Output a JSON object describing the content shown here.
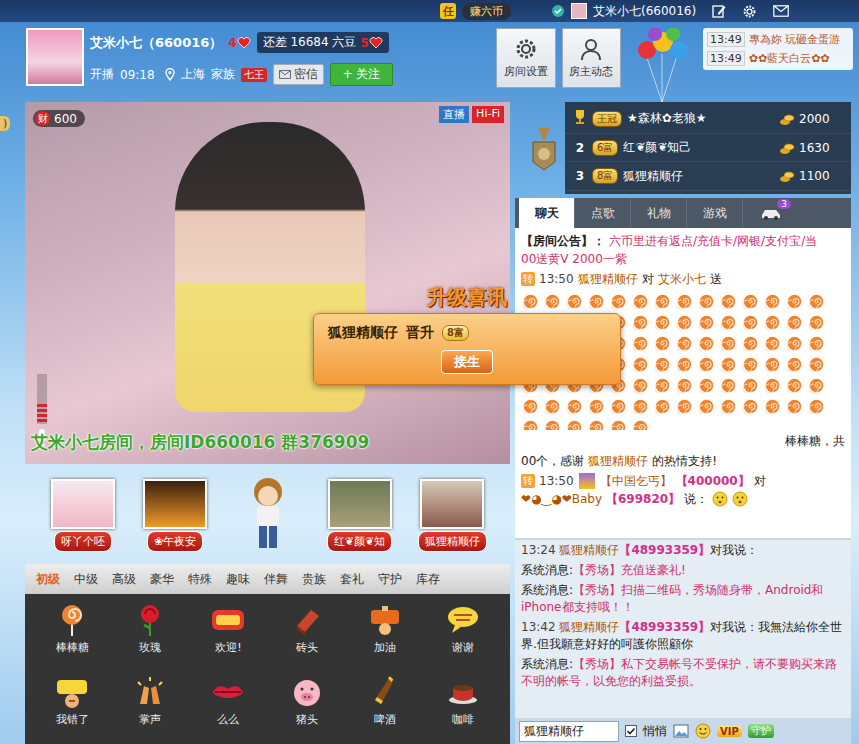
{
  "topbar": {
    "task_badge": "任",
    "task": "赚六币",
    "user": "艾米小七(660016)"
  },
  "host": {
    "name": "艾米小七（660016）",
    "level": "4",
    "needs": "还差 16684 六豆",
    "next_level": "5",
    "live_label": "开播",
    "live_time": "09:18",
    "city": "上海",
    "family_label": "家族",
    "family": "七王",
    "message": "密信",
    "follow": "+ 关注"
  },
  "actions": [
    {
      "label": "房间设置"
    },
    {
      "label": "房主动态"
    }
  ],
  "notices": [
    {
      "time": "13:49",
      "text": "專為妳 玩砸金蛋游"
    },
    {
      "time": "13:49",
      "text": "✿✿藍天白云✿✿"
    }
  ],
  "side_tab": ")",
  "video": {
    "wealth_icon": "财",
    "wealth": "600",
    "live": "直播",
    "hifi": "Hi-Fi",
    "banner": "艾米小七房间，房间ID660016 群376909",
    "mic_level": 0.4
  },
  "popup": {
    "title": "升级喜讯",
    "user": "狐狸精顺仔",
    "verb": "晋升",
    "badge": "8富",
    "button": "接生"
  },
  "audience": [
    {
      "kind": "user",
      "name": "呀丫个呸"
    },
    {
      "kind": "user",
      "name": "❀午夜安"
    },
    {
      "kind": "mascot"
    },
    {
      "kind": "user",
      "name": "红❦颜❦知"
    },
    {
      "kind": "user",
      "name": "狐狸精顺仔"
    }
  ],
  "gift_tabs": [
    {
      "label": "初级",
      "selected": true
    },
    {
      "label": "中级",
      "selected": false
    },
    {
      "label": "高级",
      "selected": false
    },
    {
      "label": "豪华",
      "selected": false
    },
    {
      "label": "特殊",
      "selected": false
    },
    {
      "label": "趣味",
      "selected": false
    },
    {
      "label": "伴舞",
      "selected": false
    },
    {
      "label": "贵族",
      "selected": false
    },
    {
      "label": "套礼",
      "selected": false
    },
    {
      "label": "守护",
      "selected": false
    },
    {
      "label": "库存",
      "selected": false
    }
  ],
  "gifts": [
    {
      "label": "棒棒糖"
    },
    {
      "label": "玫瑰"
    },
    {
      "label": "欢迎!"
    },
    {
      "label": "砖头"
    },
    {
      "label": "加油"
    },
    {
      "label": "谢谢"
    },
    {
      "label": "我错了"
    },
    {
      "label": "掌声"
    },
    {
      "label": "么么"
    },
    {
      "label": "猪头"
    },
    {
      "label": "啤酒"
    },
    {
      "label": "咖啡"
    }
  ],
  "ranking": [
    {
      "kind": "cup",
      "badge": "王冠",
      "name": "★森林✿老狼★",
      "score": "2000"
    },
    {
      "kind": "number",
      "rank": "2",
      "badge": "6富",
      "name": "红❦颜❦知己",
      "score": "1630"
    },
    {
      "kind": "number",
      "rank": "3",
      "badge": "8富",
      "name": "狐狸精顺仔",
      "score": "1100"
    }
  ],
  "chat_tabs": [
    {
      "label": "聊天",
      "selected": true
    },
    {
      "label": "点歌",
      "selected": false
    },
    {
      "label": "礼物",
      "selected": false
    },
    {
      "label": "游戏",
      "selected": false
    }
  ],
  "car_badge": "3",
  "chat": {
    "notice": {
      "label": "【房间公告】：",
      "lines": [
        "六币里进有返点/充值卡/网银/支付宝/当",
        "00送黄V 2000一紫"
      ]
    },
    "gift": {
      "tag": "转",
      "time": "13:50",
      "from": "狐狸精顺仔",
      "verb": "对",
      "to": "艾米小七",
      "action": "送",
      "item": "棒棒糖，共",
      "count": "00个，感谢",
      "user": "狐狸精顺仔",
      "tail": "的热情支持!"
    },
    "speech": {
      "tag": "转",
      "time": "13:50",
      "from": "【中国乞丐】",
      "from_id": "【400000】",
      "verb": "对",
      "to": "❤◕‿◕❤Baby",
      "to_id": "【699820】",
      "said": "说："
    }
  },
  "history": [
    {
      "kind": "private",
      "time": "13:24",
      "from": "狐狸精顺仔",
      "id": "【48993359】",
      "said": "对我说："
    },
    {
      "kind": "system",
      "label": "系统消息:",
      "tag": "【秀场】",
      "text": "充值送豪礼!"
    },
    {
      "kind": "system",
      "label": "系统消息:",
      "tag": "【秀场】",
      "text": "扫描二维码，秀场随身带，Android和iPhone都支持哦！！"
    },
    {
      "kind": "private",
      "time": "13:42",
      "from": "狐狸精顺仔",
      "id": "【48993359】",
      "said": "对我说：",
      "text": "我無法給你全世界.但我願意好好的呵護你照顧你"
    },
    {
      "kind": "system",
      "label": "系统消息:",
      "tag": "【秀场】",
      "text": "私下交易帐号不受保护，请不要购买来路不明的帐号，以免您的利益受损。"
    }
  ],
  "input": {
    "target": "狐狸精顺仔",
    "whisper": "悄悄",
    "whisper_checked": true,
    "vip": "VIP",
    "guard": "守护"
  }
}
